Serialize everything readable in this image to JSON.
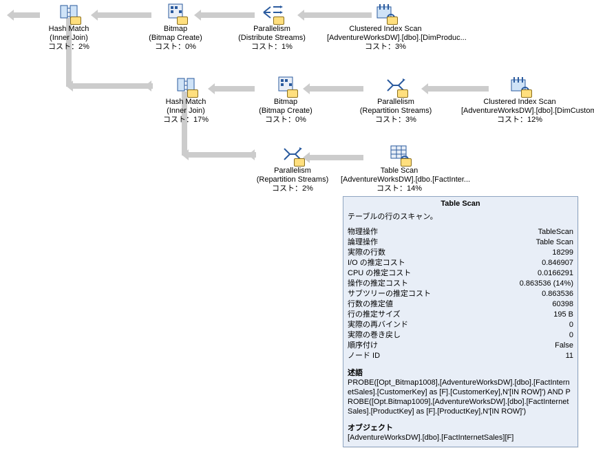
{
  "nodes": {
    "r1_hash": {
      "l1": "Hash Match",
      "l2": "(Inner Join)",
      "l3": "コスト：2%"
    },
    "r1_bitmap": {
      "l1": "Bitmap",
      "l2": "(Bitmap Create)",
      "l3": "コスト：0%"
    },
    "r1_par": {
      "l1": "Parallelism",
      "l2": "(Distribute Streams)",
      "l3": "コスト：1%"
    },
    "r1_scan": {
      "l1": "Clustered Index Scan",
      "l2": "[AdventureWorksDW].[dbo].[DimProduc...",
      "l3": "コスト：3%"
    },
    "r2_hash": {
      "l1": "Hash Match",
      "l2": "(Inner Join)",
      "l3": "コスト：17%"
    },
    "r2_bitmap": {
      "l1": "Bitmap",
      "l2": "(Bitmap Create)",
      "l3": "コスト：0%"
    },
    "r2_par": {
      "l1": "Parallelism",
      "l2": "(Repartition Streams)",
      "l3": "コスト：3%"
    },
    "r2_scan": {
      "l1": "Clustered Index Scan",
      "l2": "[AdventureWorksDW].[dbo].[DimCustom...",
      "l3": "コスト：12%"
    },
    "r3_par": {
      "l1": "Parallelism",
      "l2": "(Repartition Streams)",
      "l3": "コスト：2%"
    },
    "r3_scan": {
      "l1": "Table Scan",
      "l2": "[AdventureWorksDW].[dbo.[FactInter...",
      "l3": "コスト：14%"
    }
  },
  "tooltip": {
    "title": "Table Scan",
    "desc": "テーブルの行のスキャン。",
    "rows": [
      {
        "k": "物理操作",
        "v": "TableScan"
      },
      {
        "k": "論理操作",
        "v": "Table Scan"
      },
      {
        "k": "実際の行数",
        "v": "18299"
      },
      {
        "k": "I/O の推定コスト",
        "v": "0.846907"
      },
      {
        "k": "CPU の推定コスト",
        "v": "0.0166291"
      },
      {
        "k": "操作の推定コスト",
        "v": "0.863536 (14%)"
      },
      {
        "k": "サブツリーの推定コスト",
        "v": "0.863536"
      },
      {
        "k": "行数の推定値",
        "v": "60398"
      },
      {
        "k": "行の推定サイズ",
        "v": "195 B"
      },
      {
        "k": "実際の再バインド",
        "v": "0"
      },
      {
        "k": "実際の巻き戻し",
        "v": "0"
      },
      {
        "k": "順序付け",
        "v": "False"
      },
      {
        "k": "ノード ID",
        "v": "11"
      }
    ],
    "predicate_label": "述語",
    "predicate_text": "PROBE([Opt_Bitmap1008],[AdventureWorksDW].[dbo].[FactInternetSales].[CustomerKey] as [F].[CustomerKey],N'[IN ROW]') AND PROBE([Opt.Bitmap1009],[AdventureWorksDW].[dbo].[FactInternetSales].[ProductKey] as [F].[ProductKey],N'[IN ROW]')",
    "object_label": "オブジェクト",
    "object_text": "[AdventureWorksDW].[dbo].[FactInternetSales][F]"
  }
}
